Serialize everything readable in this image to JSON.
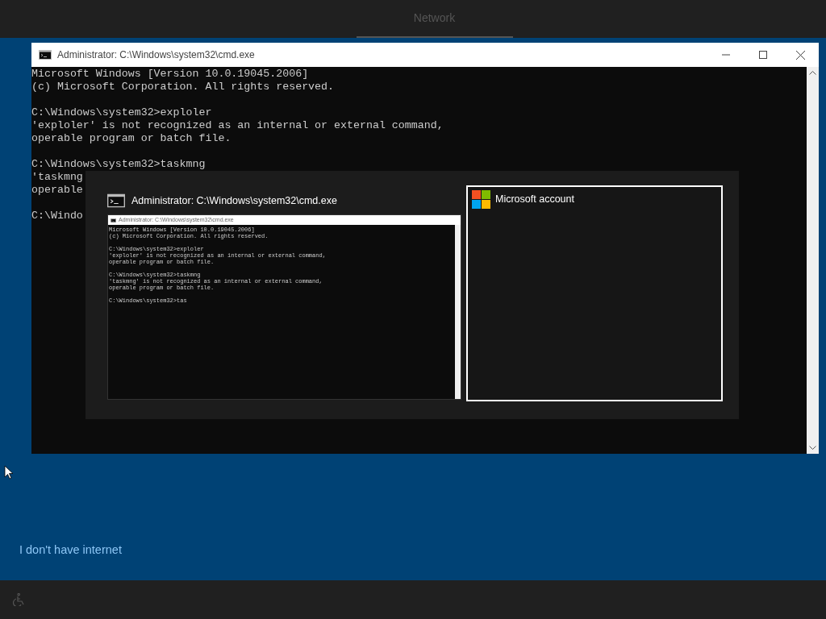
{
  "header": {
    "title": "Network"
  },
  "console_window": {
    "title": "Administrator: C:\\Windows\\system32\\cmd.exe",
    "blocks": [
      [
        "Microsoft Windows [Version 10.0.19045.2006]",
        "(c) Microsoft Corporation. All rights reserved."
      ],
      [
        "C:\\Windows\\system32>exploler",
        "'exploler' is not recognized as an internal or external command,",
        "operable program or batch file."
      ],
      [
        "C:\\Windows\\system32>taskmng",
        "'taskmng",
        "operable"
      ],
      [
        "C:\\Windo"
      ]
    ]
  },
  "task_switcher": {
    "items": [
      {
        "kind": "console",
        "selected": false,
        "title": "Administrator: C:\\Windows\\system32\\cmd.exe",
        "preview_title": "Administrator: C:\\Windows\\system32\\cmd.exe",
        "preview_blocks": [
          [
            "Microsoft Windows [Version 10.0.19045.2006]",
            "(c) Microsoft Corporation. All rights reserved."
          ],
          [
            "C:\\Windows\\system32>exploler",
            "'exploler' is not recognized as an internal or external command,",
            "operable program or batch file."
          ],
          [
            "C:\\Windows\\system32>taskmng",
            "'taskmng' is not recognized as an internal or external command,",
            "operable program or batch file."
          ],
          [
            "C:\\Windows\\system32>tas"
          ]
        ]
      },
      {
        "kind": "account",
        "selected": true,
        "title": "Microsoft account"
      }
    ]
  },
  "offline_link": "I don't have internet"
}
